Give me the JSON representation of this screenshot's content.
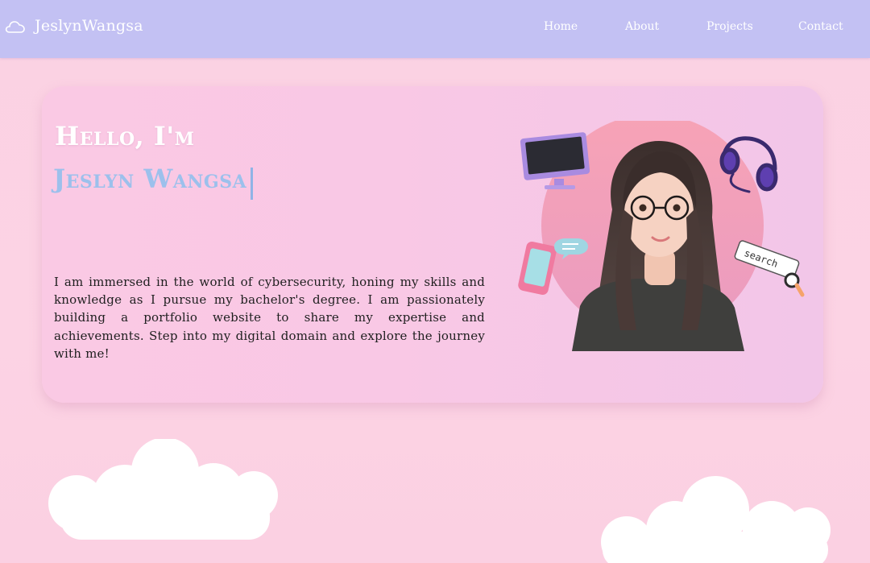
{
  "navbar": {
    "brand": "JeslynWangsa",
    "brand_icon": "cloud-icon",
    "links": [
      {
        "label": "Home"
      },
      {
        "label": "About"
      },
      {
        "label": "Projects"
      },
      {
        "label": "Contact"
      }
    ],
    "background": "#c3c1f3"
  },
  "hero": {
    "greeting": "Hello, I'm",
    "name": "Jeslyn Wangsa",
    "bio": "I am immersed in the world of cybersecurity, honing my skills and knowledge as I pursue my bachelor's degree. I am passionately building a portfolio website to share my expertise and achievements. Step into my digital domain and explore the journey with me!",
    "name_color": "#9cc0ec",
    "card_color": "#f9c8e5"
  },
  "illustration": {
    "search_label": "search",
    "icons": [
      "monitor-icon",
      "headphones-icon",
      "phone-icon",
      "chat-bubble-icon",
      "search-bar-icon",
      "magnifier-icon"
    ]
  },
  "theme": {
    "page_background": "#fcd3e4",
    "accent": "#c3c1f3"
  }
}
